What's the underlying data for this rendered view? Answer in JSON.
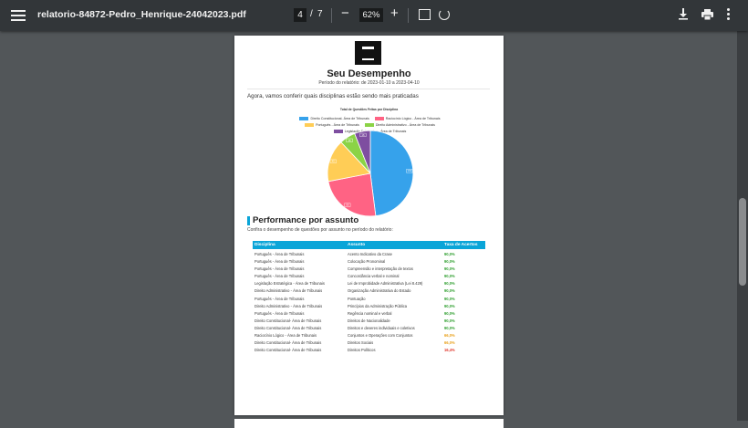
{
  "toolbar": {
    "filename": "relatorio-84872-Pedro_Henrique-24042023.pdf",
    "current_page": "4",
    "page_separator": "/",
    "total_pages": "7",
    "zoom": "62%",
    "zoom_out": "−",
    "zoom_in": "+"
  },
  "report": {
    "heading": "Seu Desempenho",
    "period": "Período do relatório: de 2023-01-10 a 2023-04-10",
    "intro": "Agora, vamos conferir quais disciplinas estão sendo mais praticadas",
    "section_title": "Performance por assunto",
    "section_subtitle": "Confira o desempenho de questões por assunto no período do relatório:"
  },
  "chart_data": {
    "type": "pie",
    "title": "Total de Questões Feitas por Disciplina",
    "categories": [
      "Direito Constitucional- Área de Tribunais",
      "Raciocínio Lógico - Área de Tribunais",
      "Português - Área de Tribunais",
      "Direito Administrativo - Área de Tribunais",
      "Legislação Estratégica - Área de Tribunais"
    ],
    "values": [
      0.48,
      0.24,
      0.16,
      0.06,
      0.06
    ],
    "colors": [
      "#36a2eb",
      "#ff6384",
      "#ffcd56",
      "#8bd346",
      "#7e4ea0"
    ],
    "slice_labels": [
      "134",
      "66",
      "45",
      "16",
      "16"
    ],
    "legend": "top"
  },
  "table": {
    "headers": [
      "Disciplina",
      "Assunto",
      "Taxa de Acertos"
    ],
    "rows": [
      {
        "d": "Português - Área de Tribunais",
        "a": "Acento Indicativo da Crase",
        "t": "90,0%",
        "c": "#2e9e2e"
      },
      {
        "d": "Português - Área de Tribunais",
        "a": "Colocação Pronominal",
        "t": "90,0%",
        "c": "#2e9e2e"
      },
      {
        "d": "Português - Área de Tribunais",
        "a": "Compreensão e interpretação de textos",
        "t": "90,0%",
        "c": "#2e9e2e"
      },
      {
        "d": "Português - Área de Tribunais",
        "a": "Concordância verbal e nominal",
        "t": "90,0%",
        "c": "#2e9e2e"
      },
      {
        "d": "Legislação Estratégica - Área de Tribunais",
        "a": "Lei de Improbidade Administrativa (Lei 8.429)",
        "t": "90,0%",
        "c": "#2e9e2e"
      },
      {
        "d": "Direito Administrativo - Área de Tribunais",
        "a": "Organização Administrativa do Estado",
        "t": "90,0%",
        "c": "#2e9e2e"
      },
      {
        "d": "Português - Área de Tribunais",
        "a": "Pontuação",
        "t": "90,0%",
        "c": "#2e9e2e"
      },
      {
        "d": "Direito Administrativo - Área de Tribunais",
        "a": "Princípios da Administração Pública",
        "t": "90,0%",
        "c": "#2e9e2e"
      },
      {
        "d": "Português - Área de Tribunais",
        "a": "Regência nominal e verbal",
        "t": "90,0%",
        "c": "#2e9e2e"
      },
      {
        "d": "Direito Constitucional- Área de Tribunais",
        "a": "Direitos de Nacionalidade",
        "t": "90,0%",
        "c": "#2e9e2e"
      },
      {
        "d": "Direito Constitucional- Área de Tribunais",
        "a": "Direitos e deveres individuais e coletivos",
        "t": "90,0%",
        "c": "#2e9e2e"
      },
      {
        "d": "Raciocínio Lógico - Área de Tribunais",
        "a": "Conjuntos e Operações com Conjuntos",
        "t": "66,0%",
        "c": "#e9a21e"
      },
      {
        "d": "Direito Constitucional- Área de Tribunais",
        "a": "Direitos Sociais",
        "t": "66,0%",
        "c": "#e9a21e"
      },
      {
        "d": "Direito Constitucional- Área de Tribunais",
        "a": "Direitos Políticos",
        "t": "16,4%",
        "c": "#e03a2f"
      }
    ]
  }
}
